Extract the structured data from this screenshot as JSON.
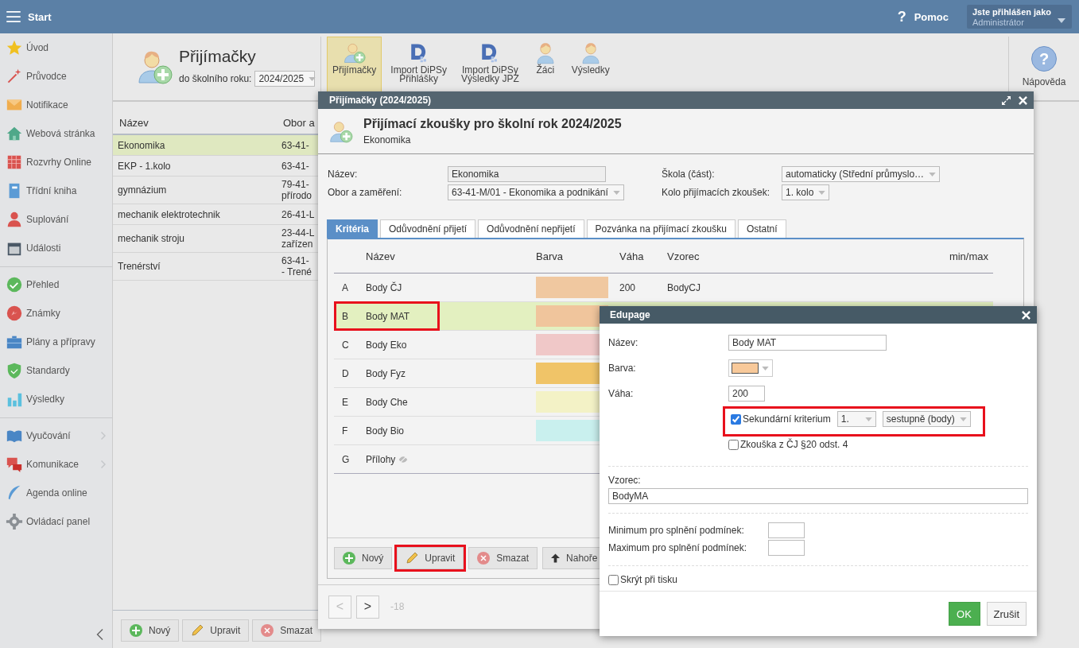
{
  "topbar": {
    "menu_label": "Start",
    "help_glyph": "?",
    "help": "Pomoc",
    "user_caption": "Jste přihlášen jako",
    "user_name": "Administrátor"
  },
  "sidebar": {
    "groups": [
      [
        {
          "label": "Úvod",
          "expandable": false
        },
        {
          "label": "Průvodce",
          "expandable": false
        },
        {
          "label": "Notifikace",
          "expandable": false
        },
        {
          "label": "Webová stránka",
          "expandable": false
        },
        {
          "label": "Rozvrhy Online",
          "expandable": false
        },
        {
          "label": "Třídní kniha",
          "expandable": false
        },
        {
          "label": "Suplování",
          "expandable": false
        },
        {
          "label": "Události",
          "expandable": false
        }
      ],
      [
        {
          "label": "Přehled",
          "expandable": false
        },
        {
          "label": "Známky",
          "expandable": false
        },
        {
          "label": "Plány a přípravy",
          "expandable": false
        },
        {
          "label": "Standardy",
          "expandable": false
        },
        {
          "label": "Výsledky",
          "expandable": false
        }
      ],
      [
        {
          "label": "Vyučování",
          "expandable": true
        },
        {
          "label": "Komunikace",
          "expandable": true
        },
        {
          "label": "Agenda online",
          "expandable": false
        },
        {
          "label": "Ovládací panel",
          "expandable": false
        }
      ]
    ]
  },
  "page_header": {
    "title": "Přijímačky",
    "year_label": "do školního roku:",
    "year": "2024/2025"
  },
  "toolbar": [
    {
      "lines": [
        "Přijímačky"
      ],
      "kind": "add",
      "selected": true
    },
    {
      "lines": [
        "Import DiPSy",
        "Přihlášky"
      ],
      "kind": "import",
      "selected": false
    },
    {
      "lines": [
        "Import DiPSy",
        "Výsledky JPZ"
      ],
      "kind": "import",
      "selected": false
    },
    {
      "lines": [
        "Žáci"
      ],
      "kind": "person",
      "selected": false
    },
    {
      "lines": [
        "Výsledky"
      ],
      "kind": "person",
      "selected": false
    }
  ],
  "help_button": {
    "glyph": "?",
    "label": "Nápověda"
  },
  "list": {
    "columns": [
      "Název",
      "Obor a"
    ],
    "rows": [
      {
        "name": "Ekonomika",
        "field": [
          "63-41-"
        ],
        "selected": true
      },
      {
        "name": "EKP - 1.kolo",
        "field": [
          "63-41-"
        ],
        "selected": false
      },
      {
        "name": "gymnázium",
        "field": [
          "79-41-",
          "přírodo"
        ],
        "selected": false
      },
      {
        "name": "mechanik elektrotechnik",
        "field": [
          "26-41-L"
        ],
        "selected": false
      },
      {
        "name": "mechanik stroju",
        "field": [
          "23-44-L",
          "zařízen"
        ],
        "selected": false
      },
      {
        "name": "Trenérství",
        "field": [
          "63-41-",
          "- Trené"
        ],
        "selected": false
      }
    ],
    "buttons": [
      "Nový",
      "Upravit",
      "Smazat"
    ]
  },
  "dialog": {
    "title": "Přijímačky (2024/2025)",
    "heading": "Přijímací zkoušky pro školní rok 2024/2025",
    "subheading": "Ekonomika",
    "fields": [
      {
        "label": "Název:",
        "value": "Ekonomika",
        "kind": "text"
      },
      {
        "label": "Škola (část):",
        "value": "automaticky (Střední průmyslo…",
        "kind": "select"
      },
      {
        "label": "Obor a zaměření:",
        "value": "63-41-M/01 - Ekonomika a podnikání",
        "kind": "select"
      },
      {
        "label": "Kolo přijímacích zkoušek:",
        "value": "1. kolo",
        "kind": "select"
      }
    ],
    "tabs": [
      {
        "label": "Kritéria",
        "selected": true
      },
      {
        "label": "Odůvodnění přijetí",
        "selected": false
      },
      {
        "label": "Odůvodnění nepřijetí",
        "selected": false
      },
      {
        "label": "Pozvánka na přijímací zkoušku",
        "selected": false
      },
      {
        "label": "Ostatní",
        "selected": false
      }
    ],
    "criteria": {
      "columns": [
        "Název",
        "Barva",
        "Váha",
        "Vzorec",
        "min/max"
      ],
      "rows": [
        {
          "letter": "A",
          "name": "Body ČJ",
          "color": "#f0c8a0",
          "weight": "200",
          "formula": "BodyCJ",
          "selected": false,
          "highlighted": false
        },
        {
          "letter": "B",
          "name": "Body MAT",
          "color": "#f0c59c",
          "selected": true,
          "highlighted": true
        },
        {
          "letter": "C",
          "name": "Body Eko",
          "color": "#f0c8c8",
          "selected": false,
          "highlighted": false
        },
        {
          "letter": "D",
          "name": "Body Fyz",
          "color": "#f0c468",
          "selected": false,
          "highlighted": false
        },
        {
          "letter": "E",
          "name": "Body Che",
          "color": "#f3f2c6",
          "selected": false,
          "highlighted": false
        },
        {
          "letter": "F",
          "name": "Body Bio",
          "color": "#c9f0ee",
          "selected": false,
          "highlighted": false
        },
        {
          "letter": "G",
          "name": "Přílohy",
          "hidden": true,
          "selected": false,
          "highlighted": false
        }
      ]
    },
    "buttons": [
      {
        "label": "Nový",
        "highlighted": false
      },
      {
        "label": "Upravit",
        "highlighted": true
      },
      {
        "label": "Smazat",
        "highlighted": false
      },
      {
        "label": "Nahoře",
        "highlighted": false
      }
    ],
    "pager": {
      "prev": "<",
      "next": ">",
      "range": "-18",
      "prev_disabled": true
    }
  },
  "editor": {
    "title": "Edupage",
    "name_label": "Název:",
    "name_value": "Body MAT",
    "color_label": "Barva:",
    "color": "#f8c99a",
    "weight_label": "Váha:",
    "weight_value": "200",
    "secondary": {
      "label": "Sekundární kriterium",
      "checked": true,
      "order": "1.",
      "direction": "sestupně (body)",
      "highlighted": true
    },
    "exam": {
      "label": "Zkouška z ČJ §20 odst. 4",
      "checked": false
    },
    "formula_label": "Vzorec:",
    "formula_value": "BodyMA",
    "min_label": "Minimum pro splnění podmínek:",
    "max_label": "Maximum pro splnění podmínek:",
    "hide_print": {
      "label": "Skrýt při tisku",
      "checked": false
    },
    "ok": "OK",
    "cancel": "Zrušit"
  }
}
